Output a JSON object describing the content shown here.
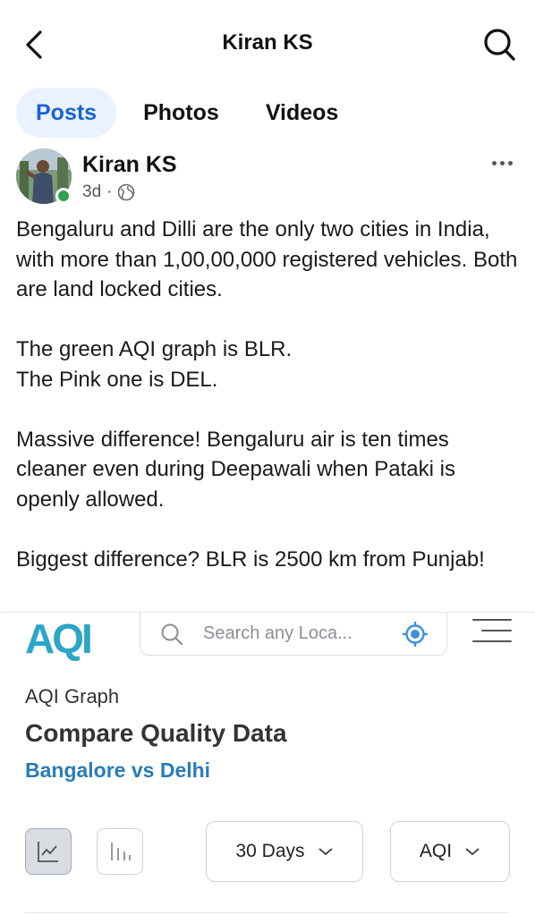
{
  "topbar": {
    "title": "Kiran KS",
    "back_icon": "chevron-left-icon",
    "search_icon": "search-icon"
  },
  "tabs": [
    {
      "label": "Posts",
      "active": true
    },
    {
      "label": "Photos",
      "active": false
    },
    {
      "label": "Videos",
      "active": false
    }
  ],
  "post": {
    "author": "Kiran KS",
    "time": "3d",
    "separator": "·",
    "privacy_icon": "globe-icon",
    "online_color": "#31a24c",
    "lines": [
      "Bengaluru and Dilli are the only two cities in India, with more than 1,00,00,000 registered vehicles. Both are land locked cities.",
      "The green AQI graph is BLR.",
      "The Pink one is DEL.",
      "Massive difference! Bengaluru air is ten times cleaner even during Deepawali when Pataki is openly allowed.",
      "Biggest difference? BLR is 2500 km from Punjab!"
    ]
  },
  "embedded": {
    "logo": "AQI",
    "search_placeholder": "Search any Loca...",
    "kicker": "AQI Graph",
    "title": "Compare Quality Data",
    "subtitle": "Bangalore vs Delhi",
    "range_dropdown": "30 Days",
    "metric_dropdown": "AQI",
    "accent": "#2a7cb8",
    "logo_color": "#2aa6c7"
  }
}
